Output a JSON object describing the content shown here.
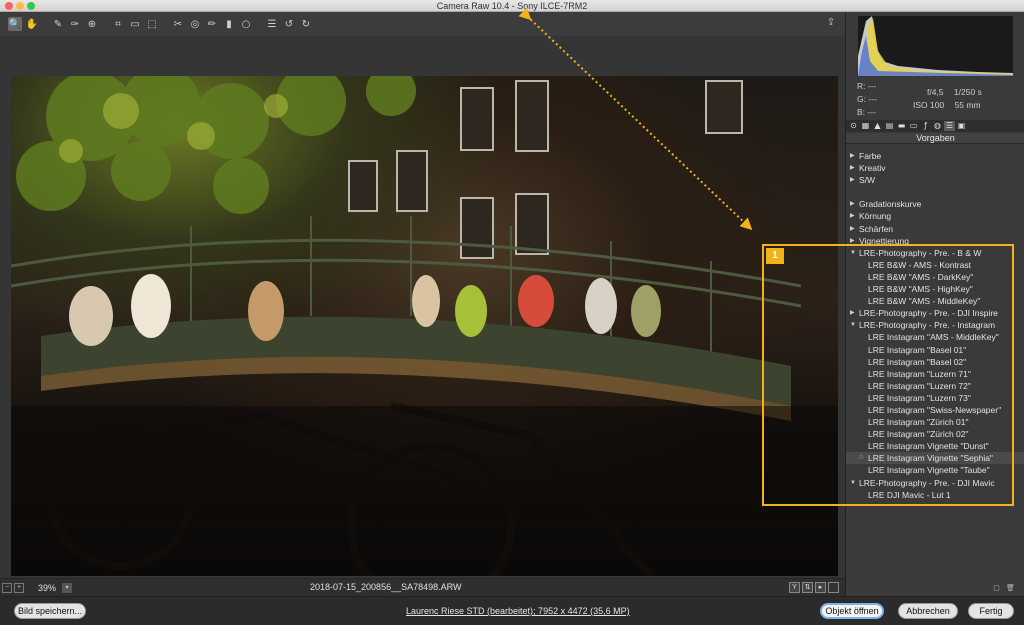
{
  "window": {
    "title": "Camera Raw 10.4  -  Sony ILCE-7RM2"
  },
  "toolbar": {
    "tools": [
      {
        "name": "zoom-tool",
        "glyph": "🔍",
        "active": true
      },
      {
        "name": "hand-tool",
        "glyph": "✋"
      },
      {
        "name": "white-balance-tool",
        "glyph": "✎"
      },
      {
        "name": "color-sampler-tool",
        "glyph": "✑"
      },
      {
        "name": "targeted-adjustment-tool",
        "glyph": "⊕"
      },
      {
        "name": "crop-tool",
        "glyph": "⌗"
      },
      {
        "name": "straighten-tool",
        "glyph": "▭"
      },
      {
        "name": "transform-tool",
        "glyph": "⬚"
      },
      {
        "name": "spot-removal-tool",
        "glyph": "✂"
      },
      {
        "name": "red-eye-tool",
        "glyph": "◎"
      },
      {
        "name": "adjustment-brush-tool",
        "glyph": "✏"
      },
      {
        "name": "graduated-filter-tool",
        "glyph": "▮"
      },
      {
        "name": "radial-filter-tool",
        "glyph": "○"
      },
      {
        "name": "preferences-tool",
        "glyph": "☰"
      },
      {
        "name": "rotate-left-tool",
        "glyph": "↺"
      },
      {
        "name": "rotate-right-tool",
        "glyph": "↻"
      }
    ],
    "export_glyph": "⇪"
  },
  "status": {
    "zoom": "39%",
    "filename": "2018-07-15_200856__SA78498.ARW"
  },
  "bottom": {
    "save_label": "Bild speichern...",
    "workflow_text": "Laurenc Riese STD (bearbeitet); 7952 x 4472 (35,6 MP)",
    "open_label": "Objekt öffnen",
    "cancel_label": "Abbrechen",
    "done_label": "Fertig"
  },
  "panel": {
    "readout": {
      "r_label": "R:",
      "g_label": "G:",
      "b_label": "B:",
      "r_value": "---",
      "g_value": "---",
      "b_value": "---",
      "aperture": "f/4,5",
      "shutter": "1/250 s",
      "iso": "ISO 100",
      "focal": "55 mm"
    },
    "title": "Vorgaben",
    "tree": [
      {
        "label": "Farbe",
        "level": 0,
        "state": "collapsed"
      },
      {
        "label": "Kreativ",
        "level": 0,
        "state": "collapsed"
      },
      {
        "label": "S/W",
        "level": 0,
        "state": "collapsed"
      },
      {
        "label": "",
        "level": 0,
        "state": "spacer"
      },
      {
        "label": "Gradationskurve",
        "level": 0,
        "state": "collapsed"
      },
      {
        "label": "Körnung",
        "level": 0,
        "state": "collapsed"
      },
      {
        "label": "Schärfen",
        "level": 0,
        "state": "collapsed"
      },
      {
        "label": "Vignettierung",
        "level": 0,
        "state": "collapsed"
      },
      {
        "label": "LRE-Photography - Pre. - B & W",
        "level": 0,
        "state": "expanded"
      },
      {
        "label": "LRE B&W - AMS - Kontrast",
        "level": 1
      },
      {
        "label": "LRE B&W \"AMS - DarkKey\"",
        "level": 1
      },
      {
        "label": "LRE B&W \"AMS - HighKey\"",
        "level": 1
      },
      {
        "label": "LRE B&W \"AMS - MiddleKey\"",
        "level": 1
      },
      {
        "label": "LRE-Photography - Pre. - DJI Inspire",
        "level": 0,
        "state": "collapsed"
      },
      {
        "label": "LRE-Photography - Pre. - Instagram",
        "level": 0,
        "state": "expanded"
      },
      {
        "label": "LRE Instagram \"AMS - MiddleKey\"",
        "level": 1
      },
      {
        "label": "LRE Instagram \"Basel 01\"",
        "level": 1
      },
      {
        "label": "LRE Instagram \"Basel 02\"",
        "level": 1
      },
      {
        "label": "LRE Instagram \"Luzern 71\"",
        "level": 1
      },
      {
        "label": "LRE Instagram \"Luzern 72\"",
        "level": 1
      },
      {
        "label": "LRE Instagram \"Luzern 73\"",
        "level": 1
      },
      {
        "label": "LRE Instagram \"Swiss-Newspaper\"",
        "level": 1
      },
      {
        "label": "LRE Instagram \"Zürich 01\"",
        "level": 1
      },
      {
        "label": "LRE Instagram \"Zürich 02\"",
        "level": 1
      },
      {
        "label": "LRE Instagram Vignette \"Dunst\"",
        "level": 1
      },
      {
        "label": "LRE Instagram Vignette \"Sephia\"",
        "level": 1,
        "selected": true,
        "star": "☆"
      },
      {
        "label": "LRE Instagram Vignette \"Taube\"",
        "level": 1
      },
      {
        "label": "LRE-Photography - Pre. - DJI Mavic",
        "level": 0,
        "state": "expanded"
      },
      {
        "label": "LRE DJI Mavic - Lut 1",
        "level": 1
      }
    ]
  },
  "annotation": {
    "badge": "1",
    "color": "#f1b319"
  }
}
